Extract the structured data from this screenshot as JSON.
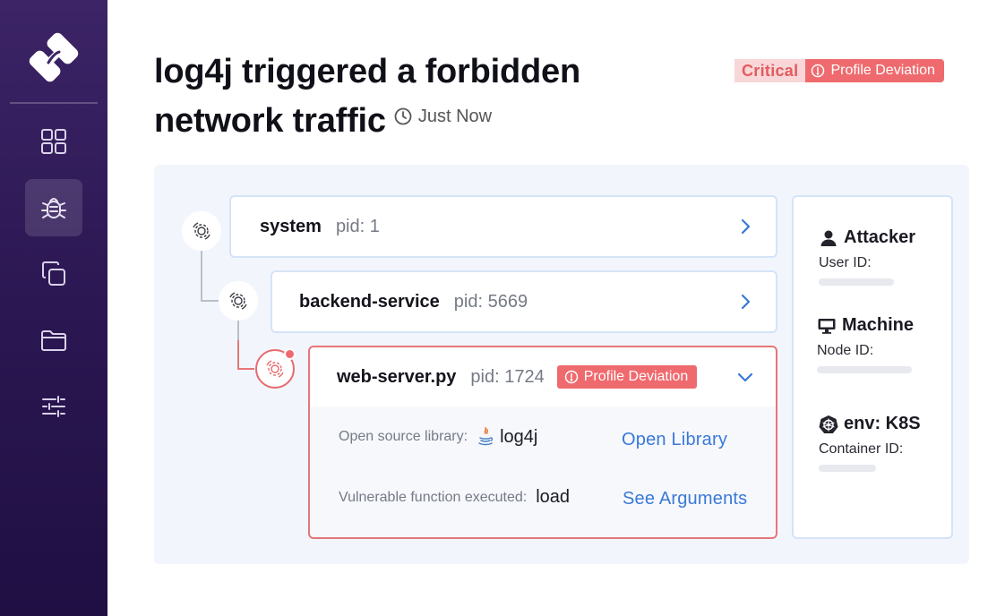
{
  "app": {
    "colors": {
      "sidebar_top": "#3c2466",
      "sidebar_bottom": "#1f0f43",
      "accent_red": "#ef6a6e",
      "link_blue": "#3a78d8",
      "panel_bg": "#f2f6fc"
    }
  },
  "sidebar": {
    "logo_icon": "brand-logo-icon",
    "items": [
      {
        "icon": "grid-icon",
        "active": false
      },
      {
        "icon": "bug-icon",
        "active": true
      },
      {
        "icon": "copy-icon",
        "active": false
      },
      {
        "icon": "folder-icon",
        "active": false
      },
      {
        "icon": "sliders-icon",
        "active": false
      }
    ]
  },
  "header": {
    "title_line1": "log4j triggered a forbidden",
    "title_line2": "network traffic",
    "timestamp": "Just Now",
    "severity": "Critical",
    "deviation_badge": "Profile Deviation"
  },
  "process_tree": [
    {
      "name": "system",
      "pid": "pid: 1",
      "expanded": false
    },
    {
      "name": "backend-service",
      "pid": "pid: 5669",
      "expanded": false
    },
    {
      "name": "web-server.py",
      "pid": "pid: 1724",
      "expanded": true,
      "badge": "Profile Deviation",
      "details": {
        "library_label": "Open source library:",
        "library_value": "log4j",
        "library_icon": "java-icon",
        "library_link": "Open Library",
        "function_label": "Vulnerable function executed:",
        "function_value": "load",
        "function_link": "See Arguments"
      }
    }
  ],
  "context": {
    "attacker": {
      "title": "Attacker",
      "label": "User ID:",
      "icon": "user-icon"
    },
    "machine": {
      "title": "Machine",
      "label": "Node ID:",
      "icon": "monitor-icon"
    },
    "env": {
      "title": "env: K8S",
      "label": "Container ID:",
      "icon": "kubernetes-icon"
    }
  }
}
